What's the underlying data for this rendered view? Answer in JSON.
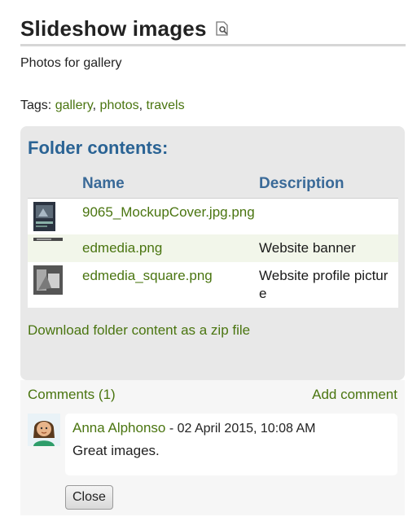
{
  "title": "Slideshow images",
  "description": "Photos for gallery",
  "tags": {
    "label": "Tags:",
    "items": [
      "gallery",
      "photos",
      "travels"
    ]
  },
  "folder": {
    "heading": "Folder contents:",
    "columns": {
      "name": "Name",
      "description": "Description"
    },
    "files": [
      {
        "name": "9065_MockupCover.jpg.png",
        "description": "",
        "thumb_icon": "image-thumbnail-cover"
      },
      {
        "name": "edmedia.png",
        "description": "Website banner",
        "thumb_icon": "image-thumbnail-banner"
      },
      {
        "name": "edmedia_square.png",
        "description": "Website profile picture",
        "thumb_icon": "image-thumbnail-square"
      }
    ],
    "download_label": "Download folder content as a zip file"
  },
  "comments": {
    "count_label": "Comments (1)",
    "add_label": "Add comment",
    "items": [
      {
        "author": "Anna Alphonso",
        "separator": " - ",
        "date": "02 April 2015, 10:08 AM",
        "text": "Great images."
      }
    ],
    "close_label": "Close"
  },
  "colors": {
    "link": "#4a7510",
    "heading_blue": "#2a6394",
    "panel_bg": "#e8e8e8"
  }
}
